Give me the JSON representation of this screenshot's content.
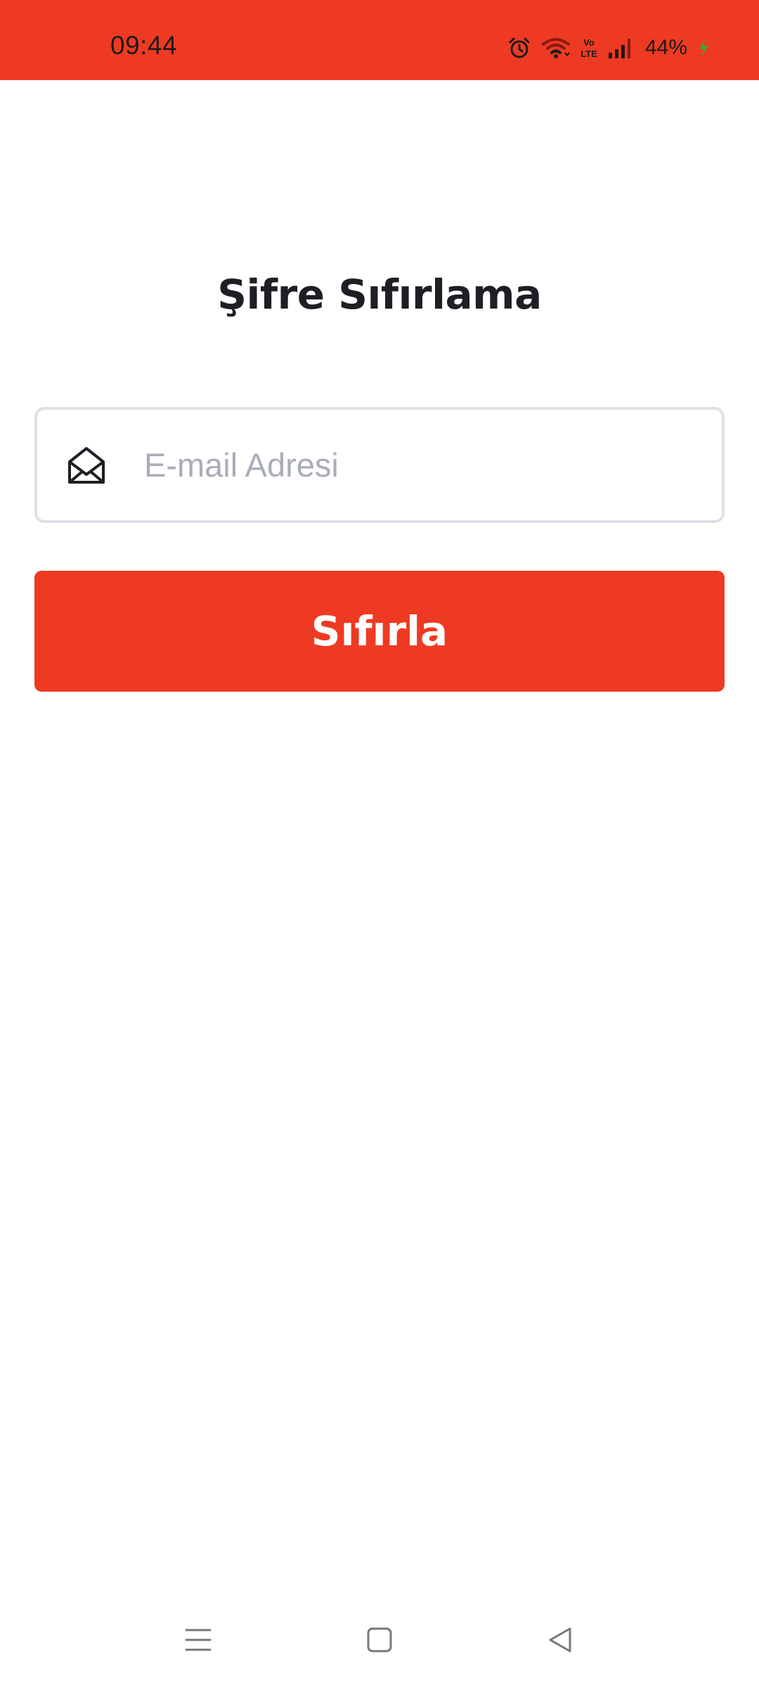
{
  "status_bar": {
    "time": "09:44",
    "battery": "44%",
    "icons": [
      "alarm-icon",
      "wifi-icon",
      "volte-icon",
      "signal-icon",
      "battery-charging-icon"
    ]
  },
  "page": {
    "title": "Şifre Sıfırlama"
  },
  "email": {
    "icon": "envelope-open-icon",
    "placeholder": "E-mail Adresi",
    "value": ""
  },
  "reset": {
    "label": "Sıfırla"
  },
  "nav": {
    "items": [
      "menu-icon",
      "home-icon",
      "back-icon"
    ]
  },
  "colors": {
    "accent": "#ee3a22",
    "title_text": "#1e1f24",
    "placeholder": "#a9adb8",
    "field_border": "#dfe0e6"
  }
}
